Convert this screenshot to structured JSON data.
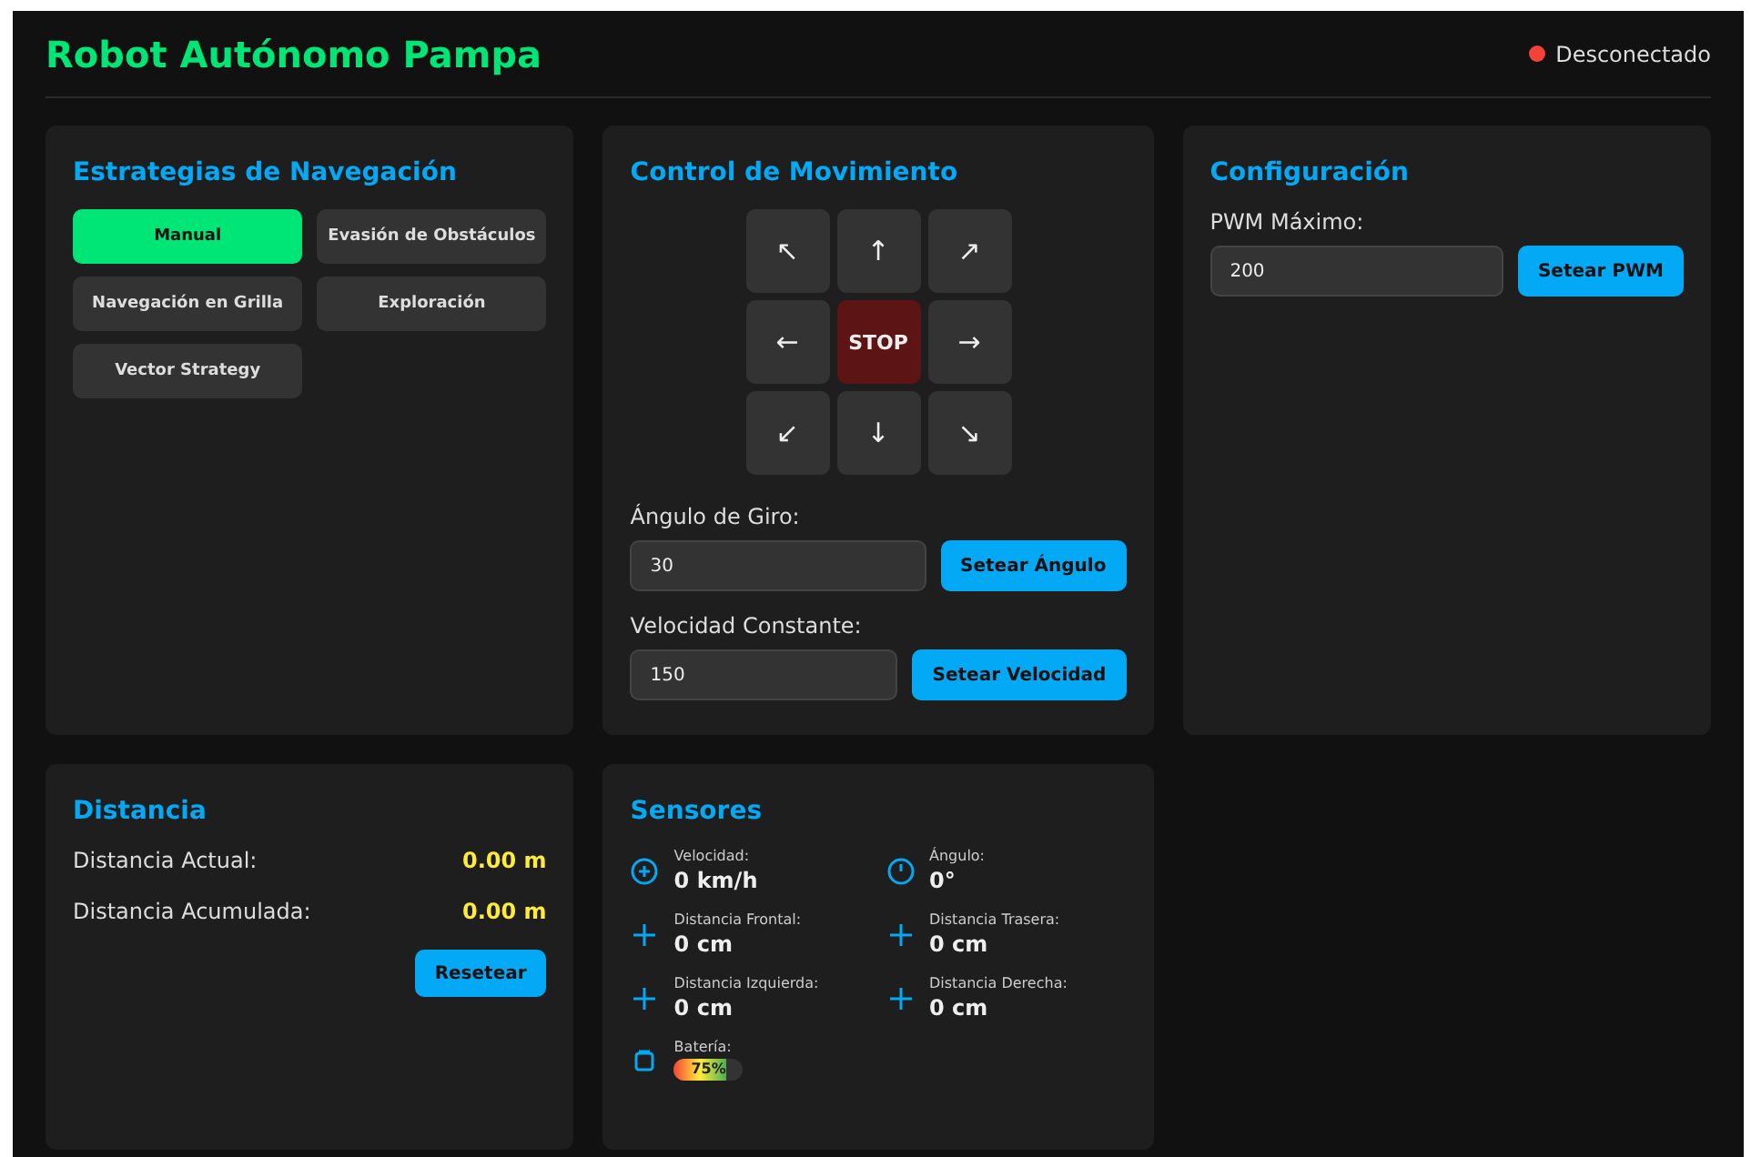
{
  "header": {
    "title": "Robot Autónomo Pampa",
    "connection": {
      "label": "Desconectado",
      "connected": false
    }
  },
  "navigation": {
    "title": "Estrategias de Navegación",
    "strategies": [
      {
        "label": "Manual",
        "selected": true
      },
      {
        "label": "Evasión de Obstáculos",
        "selected": false
      },
      {
        "label": "Navegación en Grilla",
        "selected": false
      },
      {
        "label": "Exploración",
        "selected": false
      },
      {
        "label": "Vector Strategy",
        "selected": false
      }
    ]
  },
  "movement": {
    "title": "Control de Movimiento",
    "pad": [
      {
        "label": "↖",
        "kind": "direction"
      },
      {
        "label": "↑",
        "kind": "direction"
      },
      {
        "label": "↗",
        "kind": "direction"
      },
      {
        "label": "←",
        "kind": "direction"
      },
      {
        "label": "STOP",
        "kind": "stop"
      },
      {
        "label": "→",
        "kind": "direction"
      },
      {
        "label": "↙",
        "kind": "direction"
      },
      {
        "label": "↓",
        "kind": "direction"
      },
      {
        "label": "↘",
        "kind": "direction"
      }
    ],
    "settings": [
      {
        "label": "Ángulo de Giro:",
        "value": "30",
        "button": "Setear Ángulo"
      },
      {
        "label": "Velocidad Constante:",
        "value": "150",
        "button": "Setear Velocidad"
      }
    ]
  },
  "configuration": {
    "title": "Configuración",
    "settings": [
      {
        "label": "PWM Máximo:",
        "value": "200",
        "button": "Setear PWM"
      }
    ]
  },
  "distance": {
    "title": "Distancia",
    "rows": [
      {
        "label": "Distancia Actual:",
        "value": "0.00 m"
      },
      {
        "label": "Distancia Acumulada:",
        "value": "0.00 m"
      }
    ],
    "button": "Resetear"
  },
  "sensors": {
    "title": "Sensores",
    "items": [
      {
        "kind": "speed",
        "label": "Velocidad:",
        "value": "0 km/h"
      },
      {
        "kind": "angle",
        "label": "Ángulo:",
        "value": "0°"
      },
      {
        "kind": "distance",
        "label": "Distancia Frontal:",
        "value": "0 cm"
      },
      {
        "kind": "distance",
        "label": "Distancia Trasera:",
        "value": "0 cm"
      },
      {
        "kind": "distance",
        "label": "Distancia Izquierda:",
        "value": "0 cm"
      },
      {
        "kind": "distance",
        "label": "Distancia Derecha:",
        "value": "0 cm"
      },
      {
        "kind": "battery",
        "label": "Batería:",
        "level": 0.75,
        "reading": "75%"
      }
    ]
  }
}
